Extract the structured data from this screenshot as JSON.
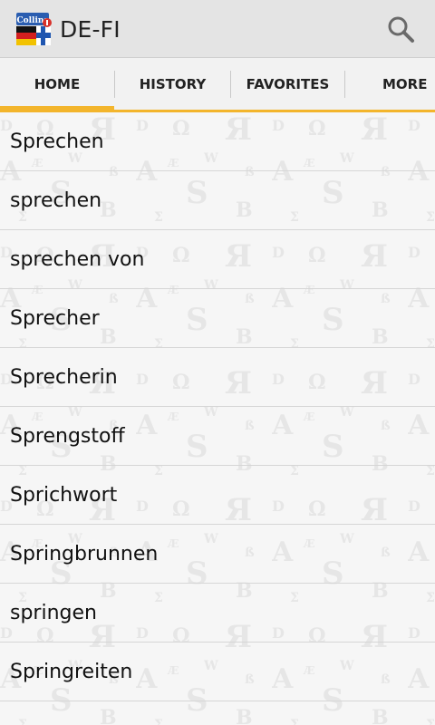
{
  "app": {
    "title": "DE-FI",
    "icon_name": "collins-app-icon",
    "icon_text": "Collins"
  },
  "header": {
    "search_icon": "search-icon"
  },
  "tabs": [
    {
      "label": "HOME",
      "active": true
    },
    {
      "label": "HISTORY",
      "active": false
    },
    {
      "label": "FAVORITES",
      "active": false
    },
    {
      "label": "MORE",
      "active": false
    }
  ],
  "list": {
    "items": [
      "Sprechen",
      "sprechen",
      "sprechen von",
      "Sprecher",
      "Sprecherin",
      "Sprengstoff",
      "Sprichwort",
      "Springbrunnen",
      "springen",
      "Springreiten"
    ]
  },
  "colors": {
    "accent": "#f3b52c",
    "actionbar": "#e4e4e4",
    "tabbar": "#f2f2f2",
    "background": "#f6f6f6"
  }
}
